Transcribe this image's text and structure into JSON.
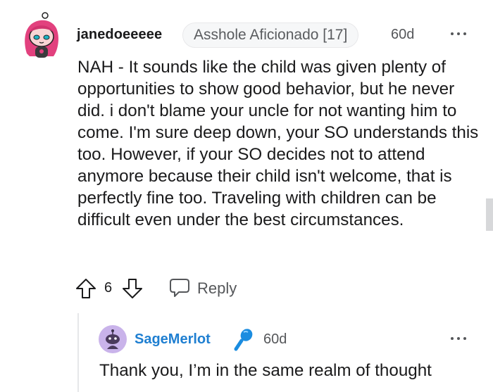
{
  "comment": {
    "author": "janedoeeeee",
    "flair": "Asshole Aficionado [17]",
    "age": "60d",
    "avatar_icon": "snoo-avatar-pink-hair",
    "body": "NAH - It sounds like the child was given plenty of opportunities to show good behavior, but he never did. i don't blame your uncle for not wanting him to come. I'm sure deep down, your SO understands this too. However, if your SO decides not to attend anymore because their child isn't welcome, that is perfectly fine too. Traveling with children can be difficult even under the best circumstances.",
    "vote_count": "6",
    "reply_label": "Reply",
    "more_icon": "more-horizontal-icon"
  },
  "reply": {
    "author": "SageMerlot",
    "age": "60d",
    "avatar_icon": "snoo-avatar-purple",
    "badge_icon": "microphone-icon",
    "body": "Thank you, I’m in the same realm of thought",
    "more_icon": "more-horizontal-icon"
  },
  "colors": {
    "text": "#1a1a1b",
    "meta": "#55575a",
    "reply_author": "#1f7fd1",
    "flair_bg": "#f6f7f8",
    "avatar_pink": "#e2417e",
    "avatar_purple": "#c9b3ea",
    "mic_blue": "#1a8ce0"
  }
}
